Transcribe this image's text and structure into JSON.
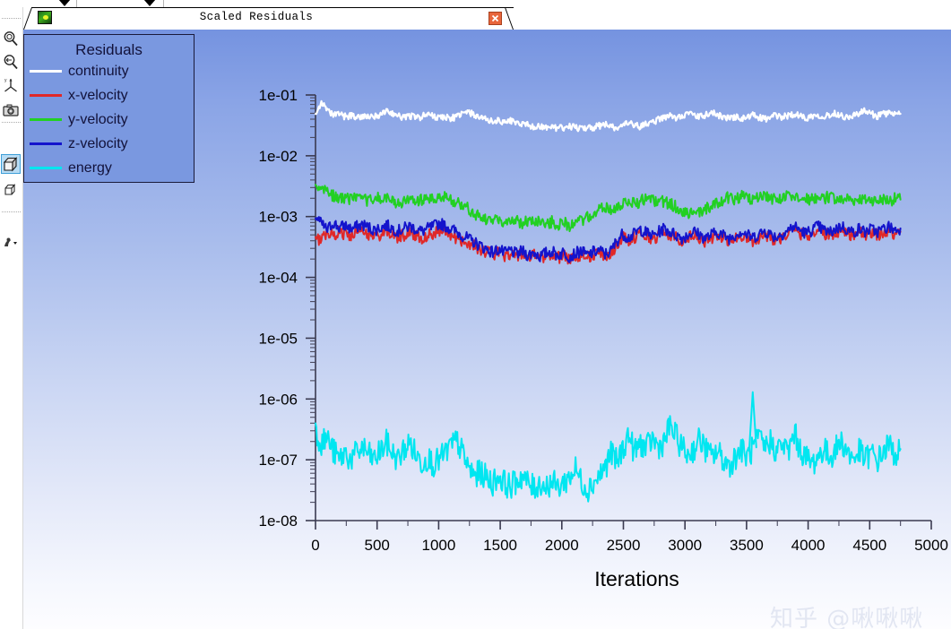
{
  "window": {
    "title": "Scaled Residuals",
    "app_icon_name": "fluent-app-icon",
    "close_label": "×"
  },
  "toolbar": {
    "items": [
      {
        "name": "zoom-in-icon",
        "label": "Zoom In",
        "selected": false
      },
      {
        "name": "zoom-out-icon",
        "label": "Zoom Out",
        "selected": false
      },
      {
        "name": "axes-icon",
        "label": "Axes",
        "selected": false
      },
      {
        "name": "camera-icon",
        "label": "Save Picture",
        "selected": false
      },
      {
        "name": "box-filled-icon",
        "label": "Fit to Window",
        "selected": true
      },
      {
        "name": "box-outline-icon",
        "label": "Reset View",
        "selected": false
      },
      {
        "name": "probe-icon",
        "label": "Probe",
        "selected": false
      }
    ]
  },
  "legend": {
    "title": "Residuals",
    "entries": [
      {
        "label": "continuity",
        "color": "#ffffff"
      },
      {
        "label": "x-velocity",
        "color": "#e02828"
      },
      {
        "label": "y-velocity",
        "color": "#22d022"
      },
      {
        "label": "z-velocity",
        "color": "#1414cc"
      },
      {
        "label": "energy",
        "color": "#00e6f0"
      }
    ]
  },
  "watermark": {
    "text": "知乎 @啾啾啾"
  },
  "chart_data": {
    "type": "line",
    "title": "Scaled Residuals",
    "xlabel": "Iterations",
    "ylabel": "",
    "yscale": "log",
    "xlim": [
      0,
      5000
    ],
    "ylim": [
      1e-08,
      0.1
    ],
    "grid": false,
    "legend_position": "top-left",
    "xticks": [
      0,
      500,
      1000,
      1500,
      2000,
      2500,
      3000,
      3500,
      4000,
      4500,
      5000
    ],
    "xticklabels": [
      "0",
      "500",
      "1000",
      "1500",
      "2000",
      "2500",
      "3000",
      "3500",
      "4000",
      "4500",
      "5000"
    ],
    "yticks": [
      0.1,
      0.01,
      0.001,
      0.0001,
      1e-05,
      1e-06,
      1e-07,
      1e-08
    ],
    "yticklabels": [
      "1e-01",
      "1e-02",
      "1e-03",
      "1e-04",
      "1e-05",
      "1e-06",
      "1e-07",
      "1e-08"
    ],
    "x_start": 0,
    "x_end": 4750,
    "series": [
      {
        "name": "continuity",
        "color": "#ffffff",
        "values": [
          0.052,
          0.075,
          0.054,
          0.046,
          0.049,
          0.044,
          0.046,
          0.043,
          0.045,
          0.042,
          0.044,
          0.048,
          0.054,
          0.05,
          0.045,
          0.043,
          0.046,
          0.042,
          0.044,
          0.048,
          0.045,
          0.042,
          0.044,
          0.041,
          0.045,
          0.049,
          0.052,
          0.046,
          0.042,
          0.039,
          0.037,
          0.038,
          0.036,
          0.038,
          0.035,
          0.034,
          0.032,
          0.03,
          0.031,
          0.029,
          0.03,
          0.028,
          0.029,
          0.031,
          0.029,
          0.028,
          0.03,
          0.029,
          0.031,
          0.033,
          0.03,
          0.029,
          0.031,
          0.034,
          0.032,
          0.03,
          0.033,
          0.036,
          0.039,
          0.042,
          0.045,
          0.042,
          0.046,
          0.05,
          0.046,
          0.043,
          0.047,
          0.051,
          0.047,
          0.044,
          0.041,
          0.044,
          0.04,
          0.043,
          0.046,
          0.043,
          0.04,
          0.043,
          0.046,
          0.043,
          0.046,
          0.049,
          0.045,
          0.042,
          0.045,
          0.048,
          0.044,
          0.047,
          0.05,
          0.046,
          0.043,
          0.046,
          0.05,
          0.054,
          0.049,
          0.045,
          0.048,
          0.051,
          0.047,
          0.049
        ]
      },
      {
        "name": "x-velocity",
        "color": "#e02828",
        "values": [
          0.00039,
          0.00046,
          0.00054,
          0.0005,
          0.00056,
          0.00052,
          0.00048,
          0.00052,
          0.00056,
          0.00051,
          0.00047,
          0.00051,
          0.00055,
          0.0005,
          0.00046,
          0.0005,
          0.00054,
          0.00049,
          0.00045,
          0.00049,
          0.00053,
          0.0006,
          0.00054,
          0.00049,
          0.00044,
          0.0004,
          0.00036,
          0.00032,
          0.00029,
          0.00026,
          0.00024,
          0.00026,
          0.00023,
          0.00025,
          0.00022,
          0.00024,
          0.00021,
          0.00023,
          0.0002,
          0.00022,
          0.00024,
          0.00021,
          0.00023,
          0.0002,
          0.00022,
          0.00024,
          0.00021,
          0.00023,
          0.00025,
          0.00022,
          0.00024,
          0.00036,
          0.00046,
          0.0004,
          0.00046,
          0.00054,
          0.00048,
          0.00043,
          0.00048,
          0.00056,
          0.0005,
          0.00045,
          0.0004,
          0.00045,
          0.0005,
          0.00044,
          0.00039,
          0.00044,
          0.00049,
          0.00043,
          0.00039,
          0.00044,
          0.0005,
          0.00044,
          0.0004,
          0.00045,
          0.00051,
          0.00045,
          0.00041,
          0.00046,
          0.00052,
          0.0006,
          0.00053,
          0.00047,
          0.00053,
          0.0006,
          0.00053,
          0.00048,
          0.00054,
          0.00061,
          0.00054,
          0.00049,
          0.00055,
          0.00049,
          0.00054,
          0.00049,
          0.00054,
          0.00059,
          0.00053,
          0.00056
        ]
      },
      {
        "name": "y-velocity",
        "color": "#22d022",
        "values": [
          0.0028,
          0.0033,
          0.0026,
          0.0022,
          0.0019,
          0.0021,
          0.0019,
          0.002,
          0.0018,
          0.0019,
          0.0021,
          0.0019,
          0.002,
          0.0018,
          0.0016,
          0.0018,
          0.0019,
          0.0017,
          0.0019,
          0.002,
          0.0018,
          0.002,
          0.0021,
          0.0019,
          0.0017,
          0.0015,
          0.0013,
          0.0011,
          0.00095,
          0.00085,
          0.00092,
          0.00082,
          0.00088,
          0.0008,
          0.00086,
          0.00078,
          0.00084,
          0.0009,
          0.00082,
          0.00076,
          0.00082,
          0.00074,
          0.0008,
          0.00072,
          0.00078,
          0.00085,
          0.00095,
          0.0011,
          0.00125,
          0.0014,
          0.0013,
          0.00145,
          0.0016,
          0.0018,
          0.00165,
          0.0018,
          0.00195,
          0.0018,
          0.00165,
          0.0018,
          0.0016,
          0.00145,
          0.0013,
          0.00115,
          0.00105,
          0.00115,
          0.0013,
          0.0015,
          0.0017,
          0.0019,
          0.0021,
          0.00195,
          0.00215,
          0.002,
          0.00185,
          0.002,
          0.0022,
          0.002,
          0.00185,
          0.002,
          0.0022,
          0.002,
          0.00185,
          0.00205,
          0.0019,
          0.0021,
          0.00195,
          0.00215,
          0.002,
          0.00185,
          0.002,
          0.00185,
          0.002,
          0.00185,
          0.00195,
          0.0018,
          0.00195,
          0.00185,
          0.00195,
          0.0019
        ]
      },
      {
        "name": "z-velocity",
        "color": "#1414cc",
        "values": [
          0.00105,
          0.00075,
          0.0006,
          0.0008,
          0.00065,
          0.00072,
          0.00062,
          0.00068,
          0.00074,
          0.00066,
          0.0006,
          0.00066,
          0.00072,
          0.00064,
          0.00058,
          0.00064,
          0.0007,
          0.00062,
          0.00057,
          0.00063,
          0.00069,
          0.00078,
          0.0007,
          0.00062,
          0.00055,
          0.00048,
          0.00042,
          0.00037,
          0.00033,
          0.00029,
          0.00026,
          0.00029,
          0.00025,
          0.00028,
          0.00024,
          0.00027,
          0.00023,
          0.00026,
          0.00022,
          0.00025,
          0.00027,
          0.00023,
          0.00026,
          0.00022,
          0.00025,
          0.00027,
          0.00023,
          0.00026,
          0.00028,
          0.00024,
          0.00027,
          0.0004,
          0.00052,
          0.00045,
          0.00052,
          0.00062,
          0.00054,
          0.00048,
          0.00055,
          0.00064,
          0.00056,
          0.0005,
          0.00044,
          0.0005,
          0.00057,
          0.0005,
          0.00044,
          0.0005,
          0.00056,
          0.00049,
          0.00044,
          0.0005,
          0.00057,
          0.0005,
          0.00045,
          0.00051,
          0.00058,
          0.00051,
          0.00046,
          0.00052,
          0.0006,
          0.00069,
          0.0006,
          0.00053,
          0.0006,
          0.00069,
          0.0006,
          0.00054,
          0.00062,
          0.0007,
          0.00061,
          0.00055,
          0.00063,
          0.00056,
          0.00062,
          0.00056,
          0.00062,
          0.00068,
          0.0006,
          0.00064
        ]
      },
      {
        "name": "energy",
        "color": "#00e6f0",
        "values": [
          3e-07,
          1.9e-07,
          2.3e-07,
          1.4e-07,
          1e-07,
          1.3e-07,
          1e-07,
          1.3e-07,
          1.6e-07,
          1.2e-07,
          1e-07,
          1.4e-07,
          1.9e-07,
          1.3e-07,
          1e-07,
          1.5e-07,
          1.9e-07,
          1.2e-07,
          9e-08,
          1.1e-07,
          8.5e-08,
          1e-07,
          1.3e-07,
          1.7e-07,
          2e-07,
          1.2e-07,
          7e-08,
          5.5e-08,
          6.2e-08,
          5e-08,
          4.2e-08,
          5.5e-08,
          4.2e-08,
          3.6e-08,
          4.5e-08,
          5.5e-08,
          4e-08,
          3.4e-08,
          4.2e-08,
          3.6e-08,
          4.4e-08,
          3.5e-08,
          4.2e-08,
          5.2e-08,
          7e-08,
          4.5e-08,
          3.3e-08,
          4.2e-08,
          5.5e-08,
          7.5e-08,
          1.3e-07,
          9e-08,
          1.5e-07,
          2.6e-07,
          1.3e-07,
          1.9e-07,
          1.5e-07,
          2.2e-07,
          1.6e-07,
          2e-07,
          3.6e-07,
          2.4e-07,
          1.6e-07,
          1.2e-07,
          1.5e-07,
          2.2e-07,
          1.5e-07,
          1.1e-07,
          1.4e-07,
          1e-07,
          8e-08,
          1.1e-07,
          1.5e-07,
          1.1e-07,
          1.5e-07,
          2.2e-07,
          1.6e-07,
          2e-07,
          1.4e-07,
          1.8e-07,
          1.3e-07,
          2.8e-07,
          1.5e-07,
          1.1e-07,
          8.5e-08,
          1.1e-07,
          1.5e-07,
          1.1e-07,
          1.5e-07,
          2e-07,
          1.4e-07,
          1e-07,
          1.4e-07,
          1e-07,
          1.3e-07,
          9.5e-08,
          1.3e-07,
          1.8e-07,
          1.2e-07,
          1.5e-07
        ],
        "spike_note": "single tall spike to ~1.3e-6 near iteration 3550"
      }
    ]
  }
}
